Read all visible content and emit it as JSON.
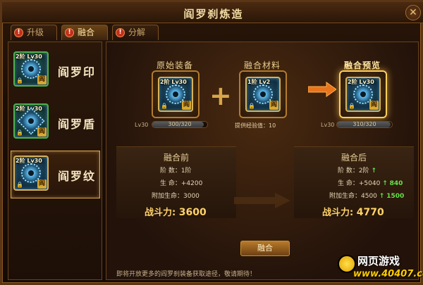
{
  "window": {
    "title": "阎罗刹炼造",
    "close_label": "✕"
  },
  "tabs": [
    {
      "label": "升级",
      "badge": "!"
    },
    {
      "label": "融合",
      "badge": "!"
    },
    {
      "label": "分解",
      "badge": "!"
    }
  ],
  "equipment_list": [
    {
      "name": "阎罗印",
      "level_tag": "2阶 Lv30",
      "seal": "阎"
    },
    {
      "name": "阎罗盾",
      "level_tag": "2阶 Lv30",
      "seal": "阎"
    },
    {
      "name": "阎罗纹",
      "level_tag": "2阶 Lv30",
      "seal": "阎"
    }
  ],
  "fusion": {
    "original": {
      "label": "原始装备",
      "level_tag": "2阶 Lv30",
      "seal": "阎",
      "lv": "Lv30",
      "progress_text": "300/320",
      "progress": 0.94
    },
    "material": {
      "label": "融合材料",
      "level_tag": "1阶 Lv2",
      "seal": "阎",
      "note": "提供经验值：10"
    },
    "preview": {
      "label": "融合预览",
      "level_tag": "2阶 Lv30",
      "seal": "阎",
      "lv": "Lv30",
      "progress_text": "310/320",
      "progress": 0.97
    },
    "plus": "+"
  },
  "before": {
    "title": "融合前",
    "rank": "阶  数：1阶",
    "hp": "生  命：+4200",
    "bonus_hp": "附加生命：3000",
    "power_label": "战斗力:",
    "power_value": "3600"
  },
  "after": {
    "title": "融合后",
    "rank": "阶  数：2阶",
    "hp": "生  命：+5040",
    "hp_gain": "840",
    "bonus_hp": "附加生命：4500",
    "bonus_gain": "1500",
    "power_label": "战斗力:",
    "power_value": "4770"
  },
  "fuse_button": "融合",
  "hint": "即将开放更多的阎罗刹装备获取途径，敬请期待！",
  "watermark": {
    "line1": "网页游戏",
    "line2": "www.40407.com"
  }
}
